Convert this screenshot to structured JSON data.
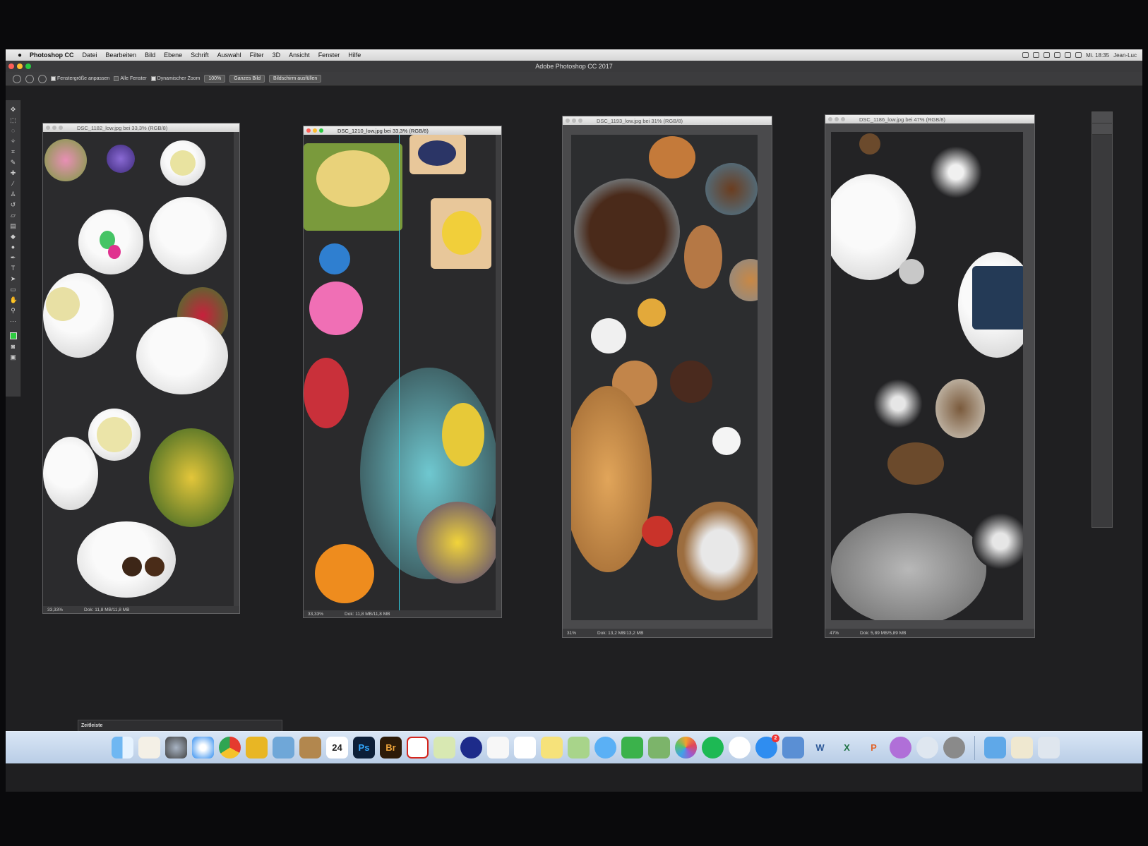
{
  "menubar": {
    "app_name": "Photoshop CC",
    "items": [
      "Datei",
      "Bearbeiten",
      "Bild",
      "Ebene",
      "Schrift",
      "Auswahl",
      "Filter",
      "3D",
      "Ansicht",
      "Fenster",
      "Hilfe"
    ],
    "clock": "Mi. 18:35",
    "user": "Jean-Luc"
  },
  "window": {
    "title": "Adobe Photoshop CC 2017"
  },
  "options": {
    "resize_windows": "Fenstergröße anpassen",
    "all_windows": "Alle Fenster",
    "scrubby_zoom": "Dynamischer Zoom",
    "btn_100": "100%",
    "btn_fit": "Ganzes Bild",
    "btn_fill": "Bildschirm ausfüllen"
  },
  "documents": [
    {
      "title": "DSC_1182_low.jpg bei 33,3% (RGB/8)",
      "zoom": "33,33%",
      "doc": "Dok: 11,8 MB/11,8 MB"
    },
    {
      "title": "DSC_1210_low.jpg bei 33,3% (RGB/8)",
      "zoom": "33,33%",
      "doc": "Dok: 11,8 MB/11,8 MB"
    },
    {
      "title": "DSC_1193_low.jpg bei 31% (RGB/8)",
      "zoom": "31%",
      "doc": "Dok: 13,2 MB/13,2 MB"
    },
    {
      "title": "DSC_1186_low.jpg bei 47% (RGB/8)",
      "zoom": "47%",
      "doc": "Dok: 5,89 MB/5,89 MB"
    }
  ],
  "timeline": {
    "title": "Zeitleiste"
  },
  "dock": {
    "icons": [
      {
        "name": "finder",
        "label": ""
      },
      {
        "name": "notes",
        "label": ""
      },
      {
        "name": "launchpad",
        "label": ""
      },
      {
        "name": "safari",
        "label": ""
      },
      {
        "name": "chrome",
        "label": ""
      },
      {
        "name": "transmit",
        "label": ""
      },
      {
        "name": "preview",
        "label": ""
      },
      {
        "name": "contacts",
        "label": ""
      },
      {
        "name": "calendar",
        "label": "24"
      },
      {
        "name": "photoshop",
        "label": "Ps"
      },
      {
        "name": "bridge",
        "label": "Br"
      },
      {
        "name": "acrobat",
        "label": ""
      },
      {
        "name": "app-a",
        "label": ""
      },
      {
        "name": "app-s",
        "label": ""
      },
      {
        "name": "textedit",
        "label": ""
      },
      {
        "name": "reminders",
        "label": ""
      },
      {
        "name": "stickies",
        "label": ""
      },
      {
        "name": "maps",
        "label": ""
      },
      {
        "name": "messages",
        "label": ""
      },
      {
        "name": "facetime",
        "label": ""
      },
      {
        "name": "image-capture",
        "label": ""
      },
      {
        "name": "photos",
        "label": ""
      },
      {
        "name": "spotify",
        "label": ""
      },
      {
        "name": "itunes",
        "label": ""
      },
      {
        "name": "app-store",
        "label": "",
        "badge": "2"
      },
      {
        "name": "app-box",
        "label": ""
      },
      {
        "name": "word",
        "label": "W"
      },
      {
        "name": "excel",
        "label": "X"
      },
      {
        "name": "powerpoint",
        "label": "P"
      },
      {
        "name": "onenote",
        "label": ""
      },
      {
        "name": "app-c",
        "label": ""
      },
      {
        "name": "system-prefs",
        "label": ""
      }
    ]
  }
}
